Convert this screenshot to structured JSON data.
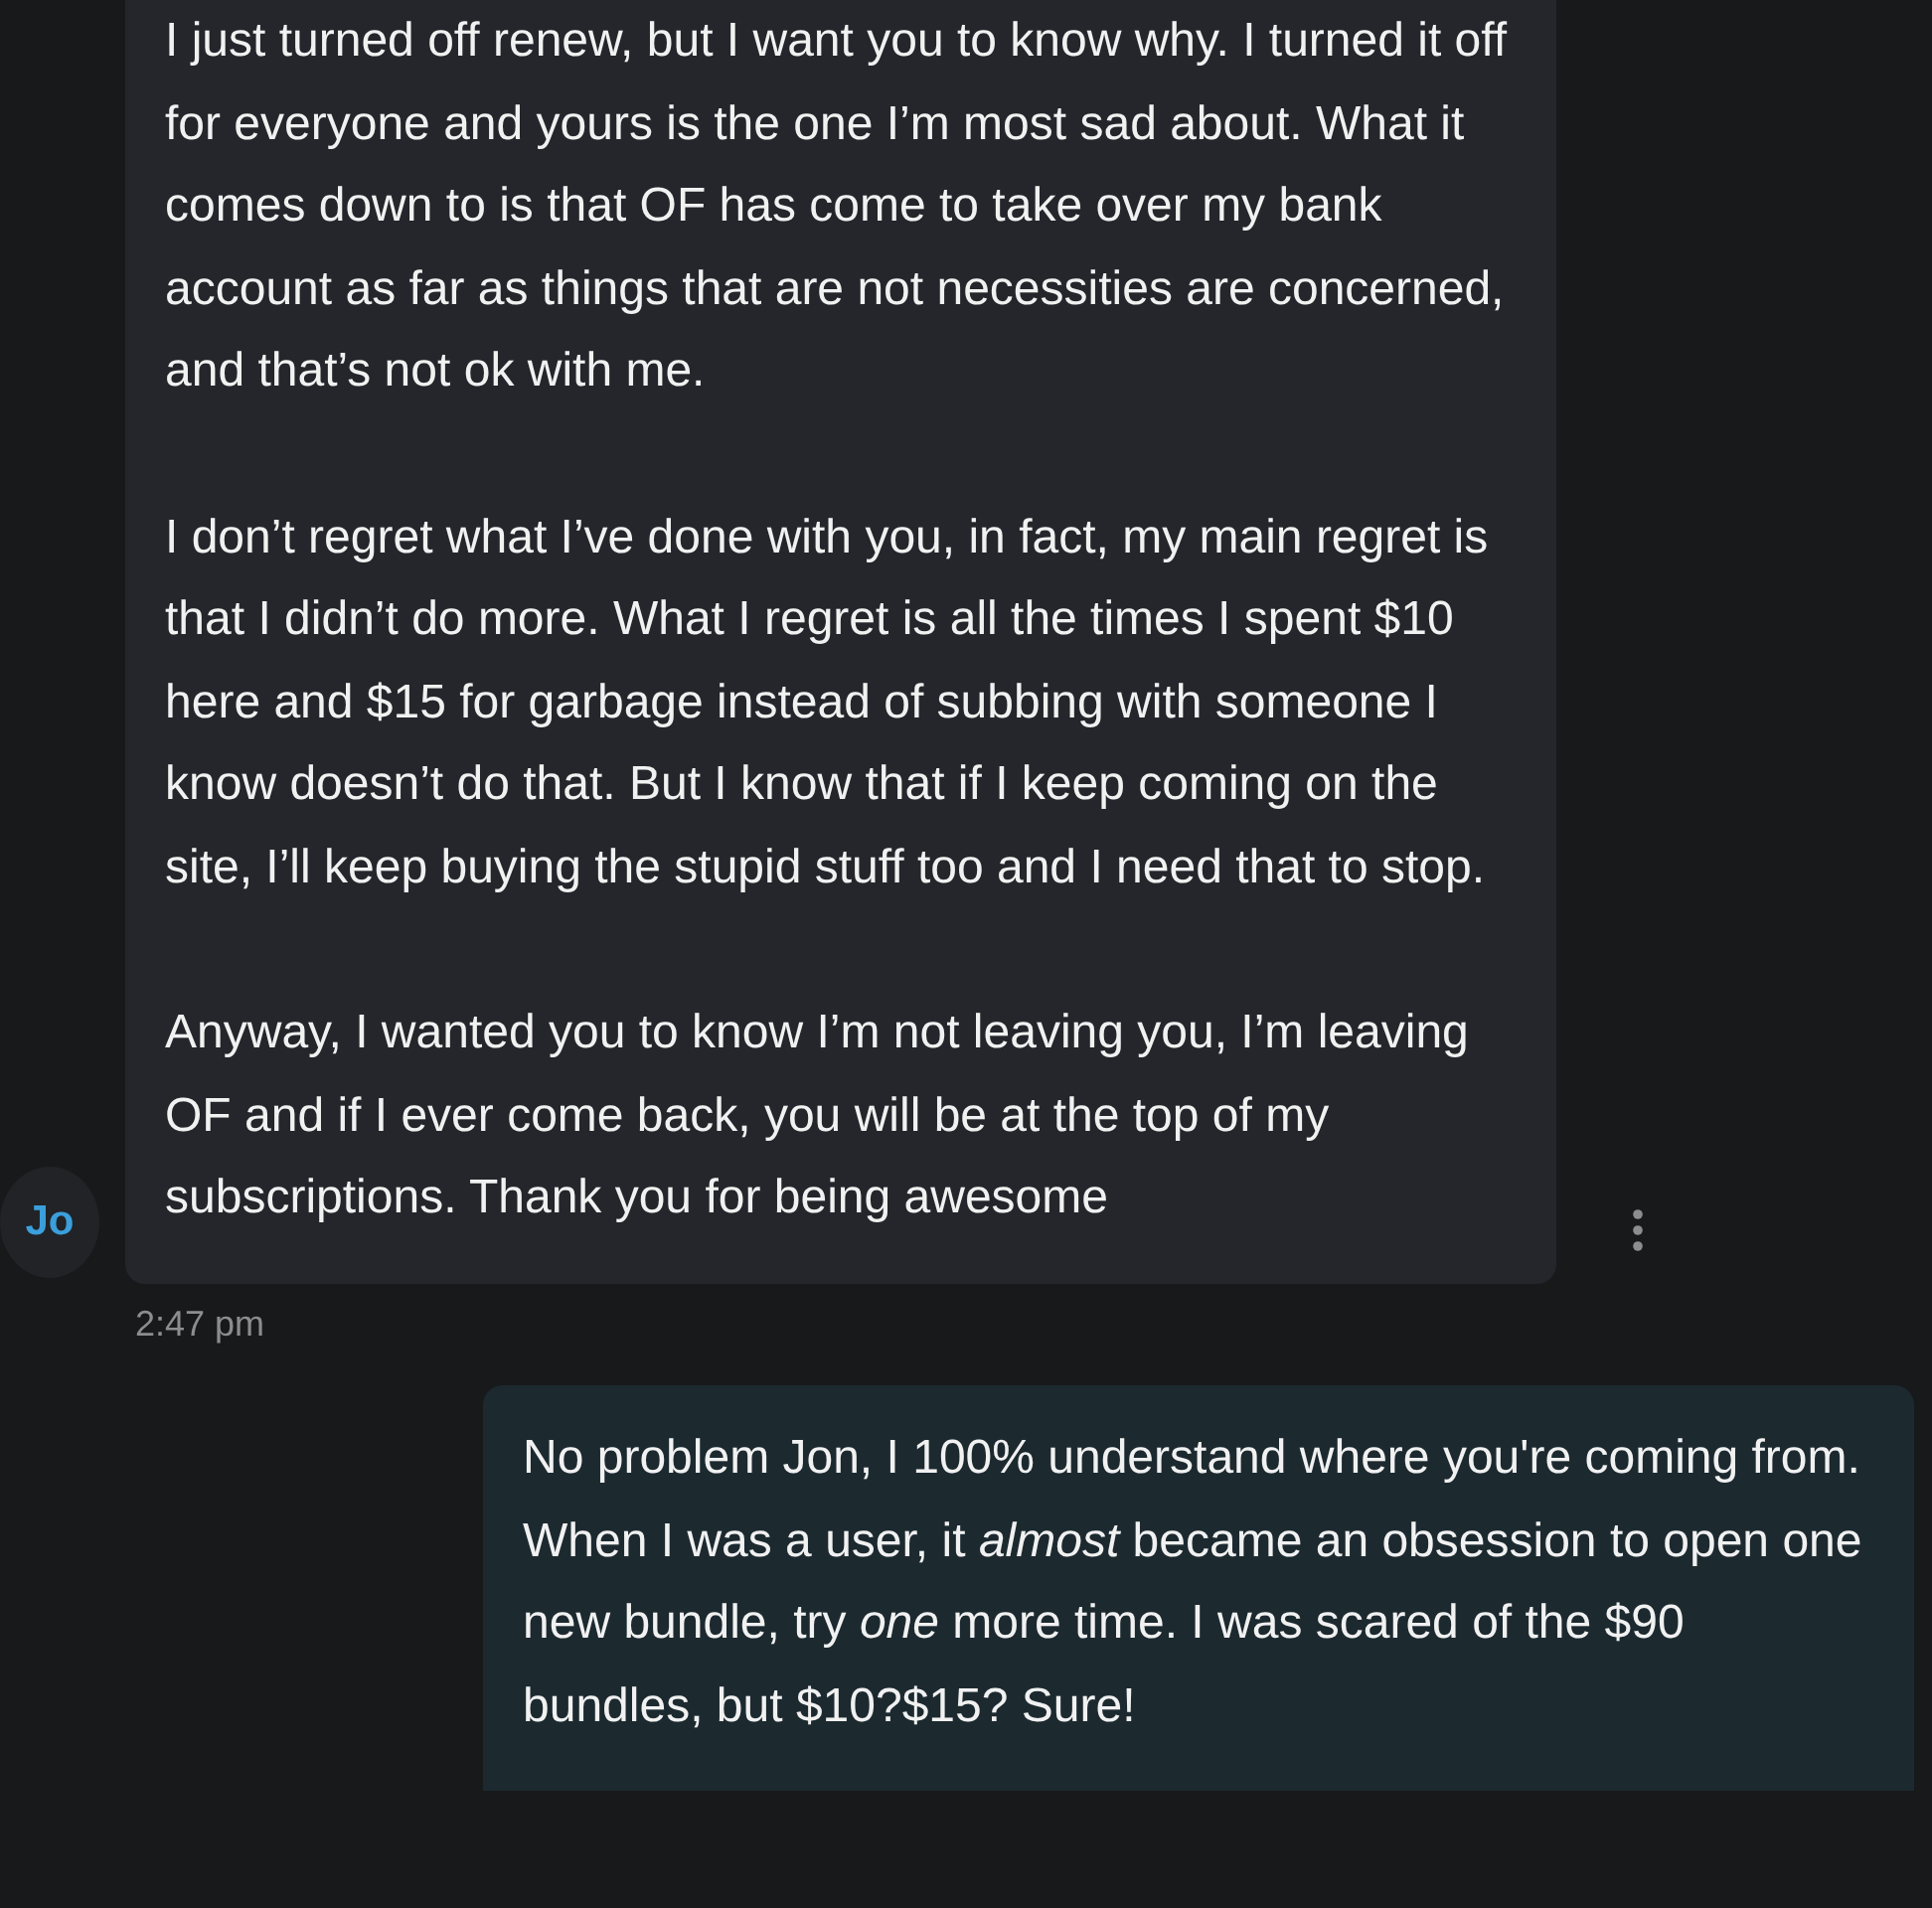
{
  "incoming": {
    "avatar": "Jo",
    "paragraphs": [
      "I just turned off renew, but I want you to know why. I turned it off for everyone and yours is the one I’m most sad about. What it comes down to is that OF has come to take over my bank account as far as things that are not necessities are concerned, and that’s not ok with me.",
      "I don’t regret what I’ve done with you, in fact, my main regret is that I didn’t do more. What I regret is all the times I spent $10 here and $15 for garbage instead of subbing with someone I know doesn’t do that. But I know that if I keep coming on the site, I’ll keep buying the stupid stuff too and I need that to stop.",
      "Anyway, I wanted you to know I’m not leaving you, I’m leaving OF and if I ever come back, you will be at the top of my subscriptions. Thank you for being awesome"
    ],
    "time": "2:47 pm"
  },
  "outgoing": {
    "paragraphs": [
      "No problem Jon, I 100% understand where you're coming from. When I was a user, it *almost* became an obsession to open one new bundle, try *one* more time. I was scared of the $90 bundles, but $10?$15? Sure!"
    ]
  }
}
